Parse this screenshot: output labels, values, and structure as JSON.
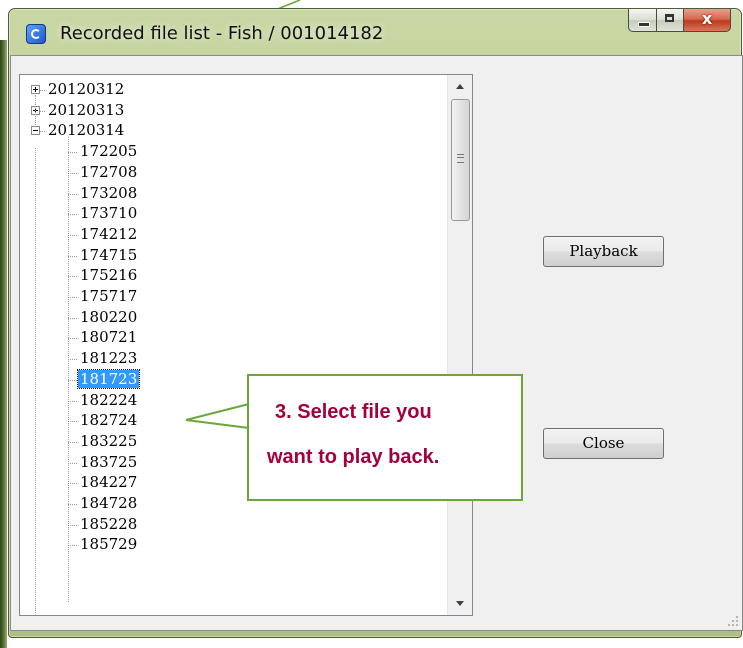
{
  "window": {
    "title": "Recorded file list - Fish / 001014182",
    "close_glyph": "x"
  },
  "tree": {
    "folders": [
      {
        "label": "20120312",
        "expanded": false
      },
      {
        "label": "20120313",
        "expanded": false
      },
      {
        "label": "20120314",
        "expanded": true
      }
    ],
    "files": [
      "172205",
      "172708",
      "173208",
      "173710",
      "174212",
      "174715",
      "175216",
      "175717",
      "180220",
      "180721",
      "181223",
      "181723",
      "182224",
      "182724",
      "183225",
      "183725",
      "184227",
      "184728",
      "185228",
      "185729"
    ],
    "selected": "181723"
  },
  "buttons": {
    "playback": "Playback",
    "close": "Close"
  },
  "callout": {
    "line1": "3. Select file you",
    "line2": "want to play back.",
    "border_color": "#6aa73a",
    "text_color": "#a3003d"
  }
}
